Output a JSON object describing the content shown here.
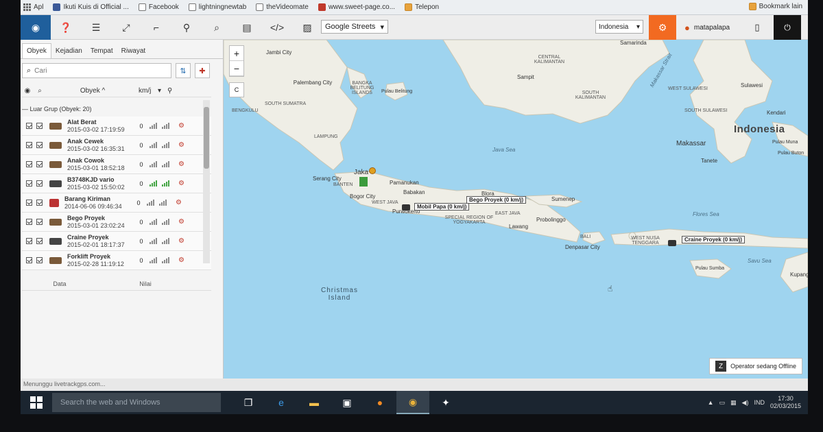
{
  "bookmarks": [
    {
      "label": "Apl",
      "icon": "apps-grid-icon"
    },
    {
      "label": "Ikuti Kuis di Official ...",
      "icon": "facebook-icon"
    },
    {
      "label": "Facebook",
      "icon": "page-icon"
    },
    {
      "label": "lightningnewtab",
      "icon": "page-icon"
    },
    {
      "label": "theVideomate",
      "icon": "page-icon"
    },
    {
      "label": "www.sweet-page.co...",
      "icon": "sweetpage-icon"
    },
    {
      "label": "Telepon",
      "icon": "folder-icon"
    }
  ],
  "bookmarks_other": "Bookmark lain",
  "toolbar": {
    "map_type": "Google Streets",
    "country": "Indonesia",
    "user": "matapalapa"
  },
  "sidebar": {
    "tabs": [
      "Obyek",
      "Kejadian",
      "Tempat",
      "Riwayat"
    ],
    "search_placeholder": "Cari",
    "columns": {
      "object": "Obyek ^",
      "speed": "km/j"
    },
    "group_label": "— Luar Grup (Obyek: 20)",
    "items": [
      {
        "name": "Alat Berat",
        "time": "2015-03-02 17:19:59",
        "speed": "0"
      },
      {
        "name": "Anak Cewek",
        "time": "2015-03-02 16:35:31",
        "speed": "0"
      },
      {
        "name": "Anak Cowok",
        "time": "2015-03-01 18:52:18",
        "speed": "0"
      },
      {
        "name": "B3748KJD vario",
        "time": "2015-03-02 15:50:02",
        "speed": "0"
      },
      {
        "name": "Barang Kiriman",
        "time": "2014-06-06 09:46:34",
        "speed": "0"
      },
      {
        "name": "Bego Proyek",
        "time": "2015-03-01 23:02:24",
        "speed": "0"
      },
      {
        "name": "Craine Proyek",
        "time": "2015-02-01 18:17:37",
        "speed": "0"
      },
      {
        "name": "Forklift Proyek",
        "time": "2015-02-28 11:19:12",
        "speed": "0"
      }
    ],
    "data_header": {
      "data": "Data",
      "value": "Nilai"
    }
  },
  "map": {
    "labels": {
      "jambi": "Jambi City",
      "palembang": "Palembang City",
      "bangka": "BANGKA BELITUNG ISLANDS",
      "south_sumatra": "SOUTH SUMATRA",
      "bengkulu": "BENGKULU",
      "lampung": "LAMPUNG",
      "central_kalimantan": "CENTRAL KALIMANTAN",
      "sampit": "Sampit",
      "south_kalimantan": "SOUTH KALIMANTAN",
      "west_sulawesi": "WEST SULAWESI",
      "sulawesi": "Sulawesi",
      "south_sulawesi": "SOUTH SULAWESI",
      "kendari": "Kendari",
      "indonesia": "Indonesia",
      "makassar": "Makassar",
      "tanete": "Tanete",
      "pulau_muna": "Pulau Muna",
      "pulau_buton": "Pulau Buton",
      "makassar_strait": "Makassar Strait",
      "java_sea": "Java Sea",
      "flores_sea": "Flores Sea",
      "savu_sea": "Savu Sea",
      "pulau_belitung": "Pulau Belitung",
      "serang": "Serang City",
      "jakarta": "Jaka",
      "banten": "BANTEN",
      "pamanukan": "Pamanukan",
      "babakan": "Babakan",
      "bogor": "Bogor City",
      "west_java": "WEST JAVA",
      "purwokerto": "Purwokerto",
      "special_region": "SPECIAL REGION OF YOGYAKARTA",
      "blora": "Blora",
      "east_java": "EAST JAVA",
      "lawang": "Lawang",
      "probolinggo": "Probolinggo",
      "sumenep": "Sumenep",
      "bali": "BALI",
      "denpasar": "Denpasar City",
      "west_nusa": "WEST NUSA TENGGARA",
      "pulau_sumba": "Pulau Sumba",
      "kupang": "Kupang",
      "christmas": "Christmas Island",
      "samarinda": "Samarinda"
    },
    "vehicle_tags": {
      "mobil_papa": "Mobil Papa (0 km/j)",
      "bego_proyek": "Bego Proyek (0 km/j)",
      "craine_proyek": "Craine Proyek (0 km/j)"
    },
    "zoom_in": "+",
    "zoom_out": "−",
    "control_c": "C",
    "operator_status": "Operator sedang Offline"
  },
  "status_url": "Menunggu livetrackgps.com...",
  "taskbar": {
    "search_placeholder": "Search the web and Windows",
    "language": "IND",
    "time": "17:30",
    "date": "02/03/2015"
  }
}
